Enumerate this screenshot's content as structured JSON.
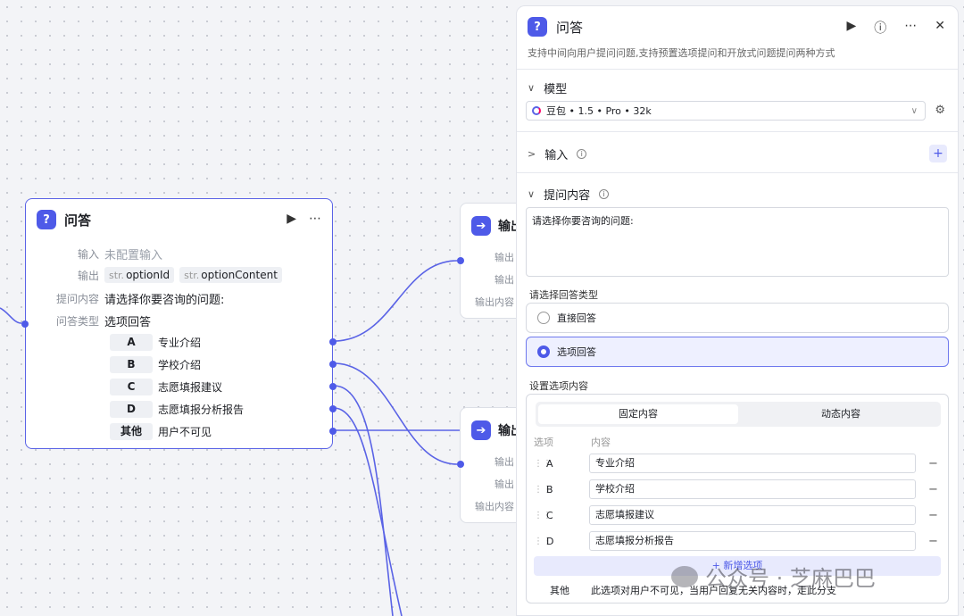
{
  "node": {
    "title": "问答",
    "input_label": "输入",
    "input_value": "未配置输入",
    "output_label": "输出",
    "output_tags": [
      {
        "prefix": "str.",
        "name": "optionId"
      },
      {
        "prefix": "str.",
        "name": "optionContent"
      }
    ],
    "question_label": "提问内容",
    "question_value": "请选择你要咨询的问题:",
    "type_label": "问答类型",
    "type_value": "选项回答",
    "options": [
      {
        "key": "A",
        "text": "专业介绍"
      },
      {
        "key": "B",
        "text": "学校介绍"
      },
      {
        "key": "C",
        "text": "志愿填报建议"
      },
      {
        "key": "D",
        "text": "志愿填报分析报告"
      },
      {
        "key": "其他",
        "text": "用户不可见"
      }
    ]
  },
  "out_nodes": [
    {
      "title": "输出",
      "rows": [
        "输出",
        "输出",
        "输出内容"
      ]
    },
    {
      "title": "输出",
      "rows": [
        "输出",
        "输出",
        "输出内容"
      ]
    }
  ],
  "panel": {
    "title": "问答",
    "description": "支持中间向用户提问问题,支持预置选项提问和开放式问题提问两种方式",
    "model_section": "模型",
    "model_value": "豆包 • 1.5 • Pro • 32k",
    "input_section": "输入",
    "question_section": "提问内容",
    "question_text": "请选择你要咨询的问题:",
    "answer_type_label": "请选择回答类型",
    "radio_direct": "直接回答",
    "radio_option": "选项回答",
    "options_label": "设置选项内容",
    "tab_fixed": "固定内容",
    "tab_dynamic": "动态内容",
    "col_option": "选项",
    "col_content": "内容",
    "rows": [
      {
        "key": "A",
        "value": "专业介绍"
      },
      {
        "key": "B",
        "value": "学校介绍"
      },
      {
        "key": "C",
        "value": "志愿填报建议"
      },
      {
        "key": "D",
        "value": "志愿填报分析报告"
      }
    ],
    "add_label": "+ 新增选项",
    "other_key": "其他",
    "other_desc": "此选项对用户不可见，当用户回复无关内容时，走此分支"
  },
  "watermark": "公众号 · 芝麻巴巴",
  "colors": {
    "accent": "#4e5ae8",
    "selected_bg": "#eef0ff"
  }
}
